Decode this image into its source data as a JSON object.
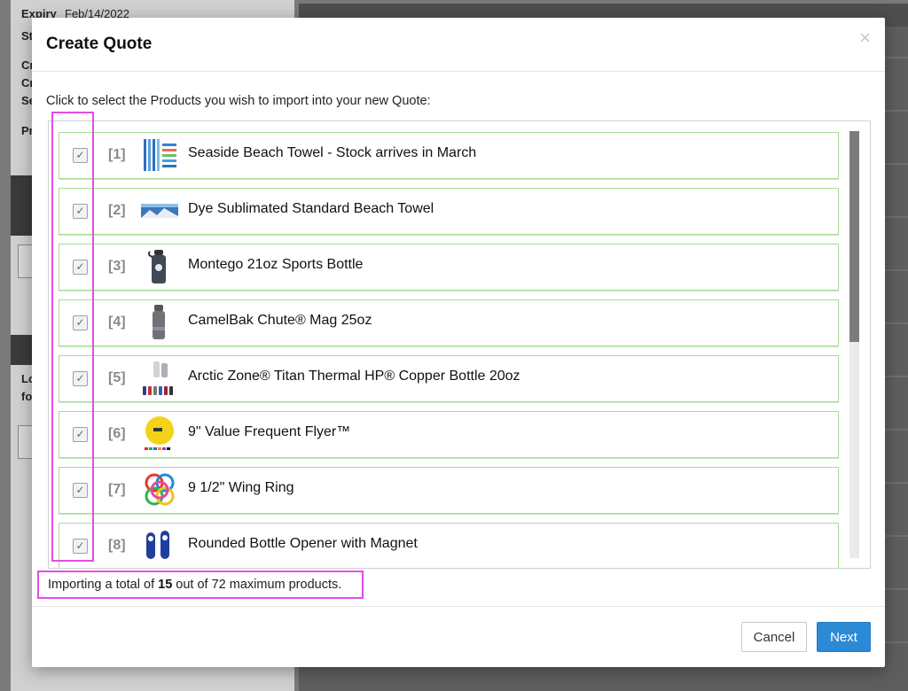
{
  "background": {
    "left_lines": [
      {
        "text": "Expiry",
        "bold": true
      },
      {
        "text": "Feb/14/2022",
        "bold": false
      },
      {
        "text": "St",
        "bold": true
      },
      {
        "text": "Cr",
        "bold": true
      },
      {
        "text": "Cr",
        "bold": true
      },
      {
        "text": "Se",
        "bold": true
      },
      {
        "text": "Pr",
        "bold": true
      },
      {
        "text": "Lo",
        "bold": true
      },
      {
        "text": "fo",
        "bold": true
      }
    ]
  },
  "modal": {
    "title": "Create Quote",
    "close_label": "×",
    "instruction": "Click to select the Products you wish to import into your new Quote:",
    "items": [
      {
        "index": "[1]",
        "name": "Seaside Beach Towel - Stock arrives in March",
        "icon": "beach-towel-icon",
        "checked": true
      },
      {
        "index": "[2]",
        "name": "Dye Sublimated Standard Beach Towel",
        "icon": "sublimated-towel-icon",
        "checked": true
      },
      {
        "index": "[3]",
        "name": "Montego 21oz Sports Bottle",
        "icon": "sports-bottle-icon",
        "checked": true
      },
      {
        "index": "[4]",
        "name": "CamelBak Chute® Mag 25oz",
        "icon": "camelbak-bottle-icon",
        "checked": true
      },
      {
        "index": "[5]",
        "name": "Arctic Zone® Titan Thermal HP® Copper Bottle 20oz",
        "icon": "thermal-bottle-icon",
        "checked": true
      },
      {
        "index": "[6]",
        "name": "9\" Value Frequent Flyer™",
        "icon": "flying-disc-icon",
        "checked": true
      },
      {
        "index": "[7]",
        "name": "9 1/2\" Wing Ring",
        "icon": "wing-ring-icon",
        "checked": true
      },
      {
        "index": "[8]",
        "name": "Rounded Bottle Opener with Magnet",
        "icon": "bottle-opener-icon",
        "checked": true
      }
    ],
    "summary": {
      "prefix": "Importing a total of ",
      "count": "15",
      "suffix": " out of 72 maximum products."
    },
    "buttons": {
      "cancel": "Cancel",
      "next": "Next"
    },
    "colors": {
      "accent": "#2b8ad6",
      "item_border": "#a8dd98",
      "highlight": "#e44ce6"
    }
  }
}
